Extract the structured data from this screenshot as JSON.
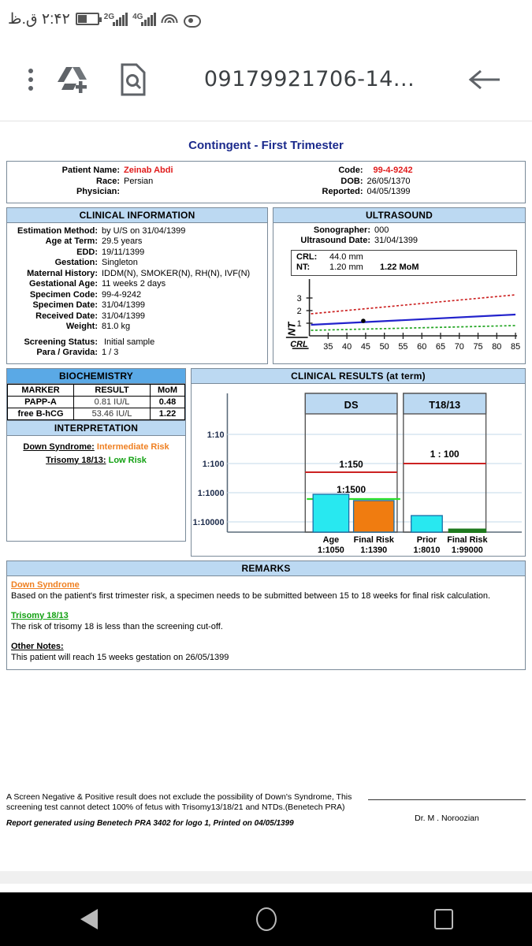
{
  "statusbar": {
    "time": "۲:۴۲ ق.ظ",
    "network_1": "2G",
    "network_2": "4G",
    "icons": [
      "battery-icon",
      "signal-2g-icon",
      "signal-4g-icon",
      "wifi-icon",
      "eye-icon"
    ]
  },
  "toolbar": {
    "title": "09179921706-14...",
    "menu_label": "more-options",
    "drive_label": "add-to-drive",
    "search_doc_label": "search-document",
    "back_label": "back"
  },
  "document": {
    "title": "Contingent - First Trimester",
    "header": {
      "left": [
        {
          "label": "Patient Name:",
          "value": "Zeinab Abdi",
          "color": "#e01b1b"
        },
        {
          "label": "Race:",
          "value": "Persian",
          "color": "#000000"
        },
        {
          "label": "Physician:",
          "value": "",
          "color": "#000000"
        }
      ],
      "right": [
        {
          "label": "Code:",
          "value": "99-4-9242",
          "color": "#e01b1b"
        },
        {
          "label": "DOB:",
          "value": "26/05/1370",
          "color": "#000000"
        },
        {
          "label": "Reported:",
          "value": "04/05/1399",
          "color": "#000000"
        }
      ]
    },
    "clinical_information": {
      "heading": "CLINICAL INFORMATION",
      "rows": [
        {
          "label": "Estimation Method:",
          "value": "by U/S on 31/04/1399"
        },
        {
          "label": "Age at Term:",
          "value": "29.5 years"
        },
        {
          "label": "EDD:",
          "value": "19/11/1399"
        },
        {
          "label": "Gestation:",
          "value": "Singleton"
        },
        {
          "label": "Maternal History:",
          "value": "IDDM(N), SMOKER(N), RH(N), IVF(N)"
        },
        {
          "label": "Gestational Age:",
          "value": "11 weeks 2 days"
        },
        {
          "label": "Specimen Code:",
          "value": "99-4-9242"
        },
        {
          "label": "Specimen Date:",
          "value": "31/04/1399"
        },
        {
          "label": "Received Date:",
          "value": "31/04/1399"
        },
        {
          "label": "Weight:",
          "value": "81.0 kg"
        },
        {
          "label": "Screening Status:",
          "value": "Initial sample"
        },
        {
          "label": "Para / Gravida:",
          "value": "1 / 3"
        }
      ]
    },
    "ultrasound": {
      "heading": "ULTRASOUND",
      "rows": [
        {
          "label": "Sonographer:",
          "value": "000"
        },
        {
          "label": "Ultrasound Date:",
          "value": "31/04/1399"
        }
      ],
      "measure": {
        "crl_label": "CRL:",
        "crl_value": "44.0 mm",
        "nt_label": "NT:",
        "nt_value": "1.20  mm",
        "nt_mom": "1.22 MoM"
      }
    },
    "biochemistry": {
      "heading": "BIOCHEMISTRY",
      "columns": [
        "MARKER",
        "RESULT",
        "MoM"
      ],
      "rows": [
        {
          "marker": "PAPP-A",
          "result": "0.81 IU/L",
          "mom": "0.48"
        },
        {
          "marker": "free B-hCG",
          "result": "53.46 IU/L",
          "mom": "1.22"
        }
      ]
    },
    "interpretation": {
      "heading": "INTERPRETATION",
      "rows": [
        {
          "label": "Down Syndrome:",
          "value": "Intermediate Risk",
          "color": "#ef8022"
        },
        {
          "label": "Trisomy 18/13:",
          "value": "Low Risk",
          "color": "#13a113"
        }
      ]
    },
    "clinical_results": {
      "heading": "CLINICAL RESULTS (at term)"
    },
    "remarks": {
      "heading": "REMARKS",
      "blocks": [
        {
          "title": "Down Syndrome",
          "color": "#ef8022",
          "text": "Based on the patient's first trimester risk, a specimen needs to be submitted between 15 to 18 weeks for final risk calculation."
        },
        {
          "title": "Trisomy 18/13",
          "color": "#13a113",
          "text": "The risk of trisomy 18 is less than the screening cut-off."
        },
        {
          "title": "Other Notes:",
          "color": "#000000",
          "text": "This patient will reach 15 weeks gestation on 26/05/1399"
        }
      ]
    },
    "footer": {
      "disclaimer": "A Screen Negative & Positive result does not exclude the possibility of Down's Syndrome, This screening test cannot detect 100% of fetus with Trisomy13/18/21 and NTDs.(Benetech PRA)",
      "generated": "Report generated using Benetech PRA 3402 for logo 1, Printed on 04/05/1399",
      "signature": "Dr. M . Noroozian"
    }
  },
  "chart_data": [
    {
      "type": "line",
      "name": "nt-crl-chart",
      "title": "",
      "xlabel": "CRL",
      "ylabel": "NT",
      "xlim": [
        30,
        86
      ],
      "ylim": [
        0,
        3.6
      ],
      "xticks": [
        35,
        40,
        45,
        50,
        55,
        60,
        65,
        70,
        75,
        80,
        85
      ],
      "yticks": [
        1,
        2,
        3
      ],
      "grid": false,
      "series": [
        {
          "name": "upper-limit",
          "color": "#cc2222",
          "style": "dotted",
          "x": [
            30,
            85
          ],
          "y": [
            1.75,
            3.25
          ]
        },
        {
          "name": "median",
          "color": "#2222cc",
          "style": "solid",
          "x": [
            30,
            85
          ],
          "y": [
            0.88,
            1.68
          ]
        },
        {
          "name": "lower-limit",
          "color": "#22a522",
          "style": "dotted",
          "x": [
            30,
            85
          ],
          "y": [
            0.45,
            0.85
          ]
        }
      ],
      "points": [
        {
          "name": "patient-nt",
          "x": 44,
          "y": 1.32,
          "color": "#000000"
        }
      ]
    },
    {
      "type": "bar",
      "name": "clinical-results-chart",
      "title": "CLINICAL RESULTS (at term)",
      "ylabel": "",
      "yticks": [
        "1:10",
        "1:100",
        "1:1000",
        "1:10000"
      ],
      "grid": true,
      "groups": [
        {
          "name": "DS",
          "cutoff_label": "1:150",
          "cutoff_color": "#cc2222",
          "marker_label": "1:1500",
          "marker_color": "#2ae02a",
          "bars": [
            {
              "label": "Age",
              "value": "1:1050",
              "color": "#28e8f0"
            },
            {
              "label": "Final Risk",
              "value": "1:1390",
              "color": "#f07c10"
            }
          ]
        },
        {
          "name": "T18/13",
          "cutoff_label": "1 : 100",
          "cutoff_color": "#cc2222",
          "marker_label": "",
          "marker_color": "",
          "bars": [
            {
              "label": "Prior",
              "value": "1:8010",
              "color": "#28e8f0"
            },
            {
              "label": "Final Risk",
              "value": "1:99000",
              "color": "#1e7a1e"
            }
          ]
        }
      ]
    }
  ],
  "navbar": {
    "back": "back-nav",
    "home": "home-nav",
    "recents": "recents-nav"
  }
}
